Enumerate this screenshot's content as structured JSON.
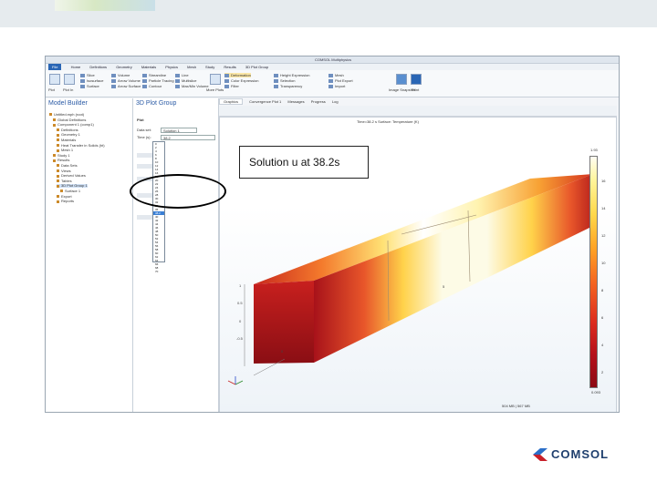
{
  "window": {
    "title": "COMSOL Multiphysics"
  },
  "menu": {
    "items": [
      "File",
      "Home",
      "Definitions",
      "Geometry",
      "Materials",
      "Physics",
      "Mesh",
      "Study",
      "Results",
      "3D Plot Group"
    ]
  },
  "ribbon": {
    "plot_label": "Plot",
    "plot_in_label": "Plot In",
    "groups": [
      "Slice",
      "Isosurface",
      "Surface",
      "Volume",
      "Arrow Volume",
      "Arrow Surface",
      "Streamline",
      "Particle Tracing",
      "Contour",
      "Line",
      "Multislice",
      "Max/Min Volume",
      "Mesh",
      "Plot Export",
      "Import"
    ],
    "attributes": [
      "Deformation",
      "Color Expression",
      "Filter",
      "Height Expression",
      "Selection",
      "Transparency"
    ],
    "print_label": "Print",
    "image_label": "Image Snapshot",
    "more_label": "More Plots"
  },
  "model_builder": {
    "title": "Model Builder",
    "tree": [
      "Untitled.mph (root)",
      "Global Definitions",
      "Component 1 (comp1)",
      "Definitions",
      "Geometry 1",
      "Materials",
      "Heat Transfer in Solids (ht)",
      "Mesh 1",
      "Study 1",
      "Results",
      "Data Sets",
      "Views",
      "Derived Values",
      "Tables",
      "3D Plot Group 1",
      "Surface 1",
      "Export",
      "Reports"
    ]
  },
  "settings": {
    "title": "3D Plot Group",
    "label": "Plot",
    "data_set_label": "Data set:",
    "data_set_value": "Solution 1",
    "time_label": "Time (s):",
    "time_options": [
      "0",
      "2",
      "4",
      "6",
      "8",
      "10",
      "12",
      "14",
      "16",
      "18",
      "20",
      "22",
      "24",
      "26",
      "28",
      "30",
      "32",
      "34",
      "36",
      "38.2",
      "40",
      "42",
      "44",
      "46",
      "48",
      "50",
      "52",
      "54",
      "56",
      "58",
      "60",
      "62",
      "64",
      "66",
      "68",
      "70"
    ],
    "selected_time": "38.2"
  },
  "graphics": {
    "tabs": [
      "Graphics",
      "Convergence Plot 1",
      "Messages",
      "Progress",
      "Log"
    ],
    "plot_title": "Time=38.2 s   Surface: Temperature (K)",
    "annotation": "Solution u at 38.2s",
    "colorbar_max": "1.93",
    "colorbar_ticks": [
      "16",
      "14",
      "12",
      "10",
      "8",
      "6",
      "4",
      "2"
    ],
    "colorbar_min": "0.093",
    "axis_ticks": [
      "1",
      "0.5",
      "0",
      "-0.5",
      "0",
      "5"
    ]
  },
  "status_bar": {
    "memory": "504 MB | 567 MB"
  },
  "brand": {
    "name": "COMSOL"
  },
  "colors": {
    "accent": "#2a66b5",
    "brand": "#1f3f6e",
    "selection": "#3a7fd5"
  }
}
